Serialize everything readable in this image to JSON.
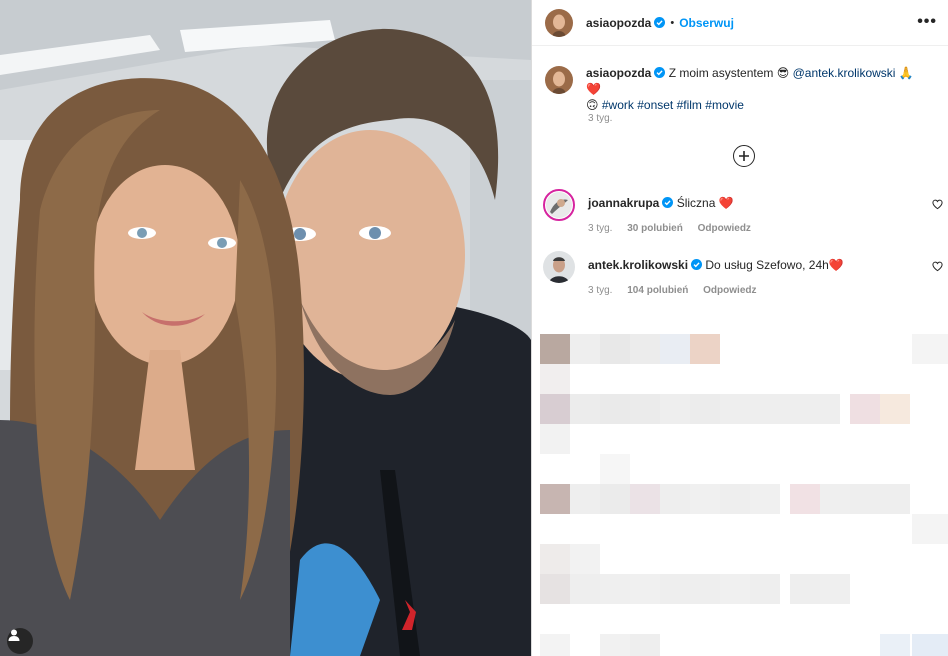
{
  "post": {
    "author": "asiaopozda",
    "follow_label": "Obserwuj",
    "dot": "•",
    "more_label": "•••",
    "caption": {
      "text_before": "Z moim asystentem 😎",
      "mention": "@antek.krolikowski",
      "text_after": "🙏 ❤️",
      "emoji_line_start": "🙃",
      "hashtags": [
        "#work",
        "#onset",
        "#film",
        "#movie"
      ],
      "time": "3 tyg."
    }
  },
  "comments": [
    {
      "user": "joannakrupa",
      "verified": true,
      "text": "Śliczna",
      "emoji": "❤️",
      "time": "3 tyg.",
      "likes": "30 polubień",
      "reply": "Odpowiedz"
    },
    {
      "user": "antek.krolikowski",
      "verified": true,
      "text": "Do usług Szefowo, 24h",
      "emoji": "❤️",
      "time": "3 tyg.",
      "likes": "104 polubień",
      "reply": "Odpowiedz"
    }
  ],
  "colors": {
    "accent": "#0095f6",
    "link": "#00376b",
    "muted": "#8e8e8e",
    "text": "#262626",
    "heart": "#ed4956"
  },
  "icons": [
    "verified-badge-icon",
    "more-options-icon",
    "load-more-plus-icon",
    "heart-outline-icon",
    "user-tag-icon"
  ]
}
